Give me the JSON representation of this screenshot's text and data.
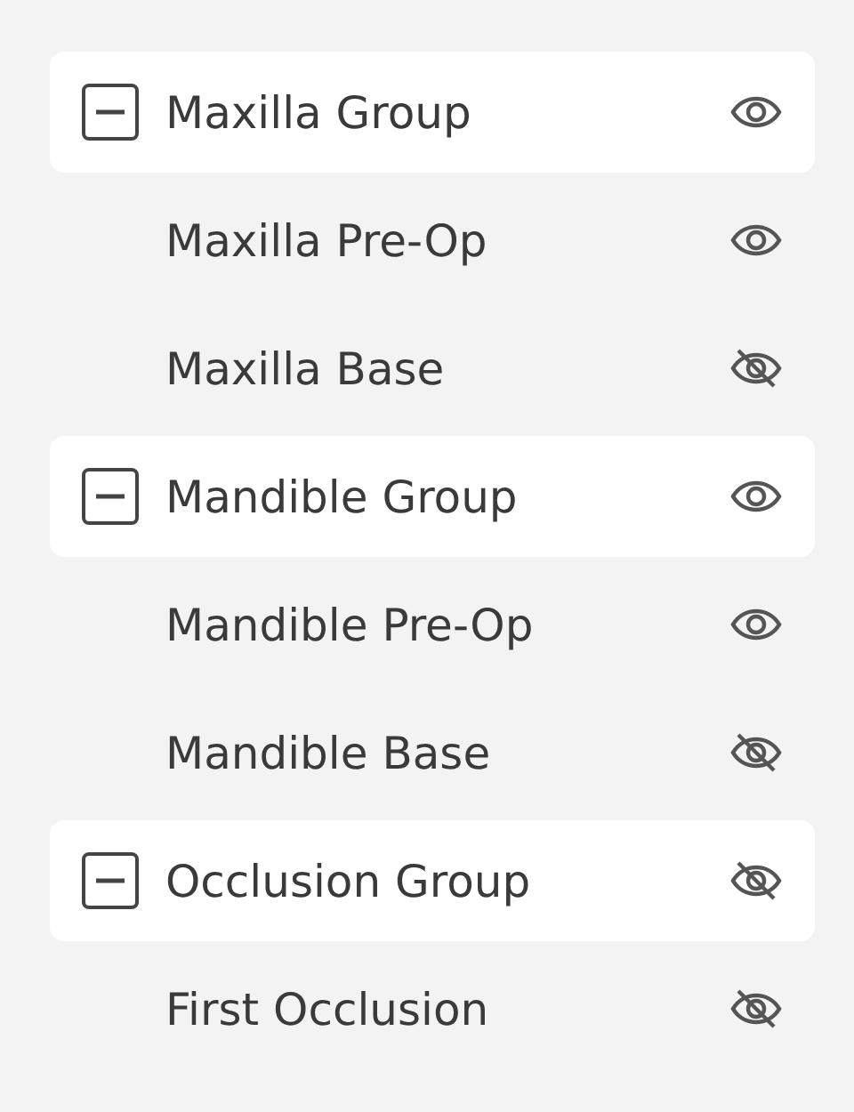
{
  "groups": [
    {
      "label": "Maxilla Group",
      "expanded": true,
      "visible": true,
      "children": [
        {
          "label": "Maxilla Pre-Op",
          "visible": true
        },
        {
          "label": "Maxilla Base",
          "visible": false
        }
      ]
    },
    {
      "label": "Mandible Group",
      "expanded": true,
      "visible": true,
      "children": [
        {
          "label": "Mandible Pre-Op",
          "visible": true
        },
        {
          "label": "Mandible Base",
          "visible": false
        }
      ]
    },
    {
      "label": "Occlusion Group",
      "expanded": true,
      "visible": false,
      "children": [
        {
          "label": "First Occlusion",
          "visible": false
        }
      ]
    }
  ]
}
